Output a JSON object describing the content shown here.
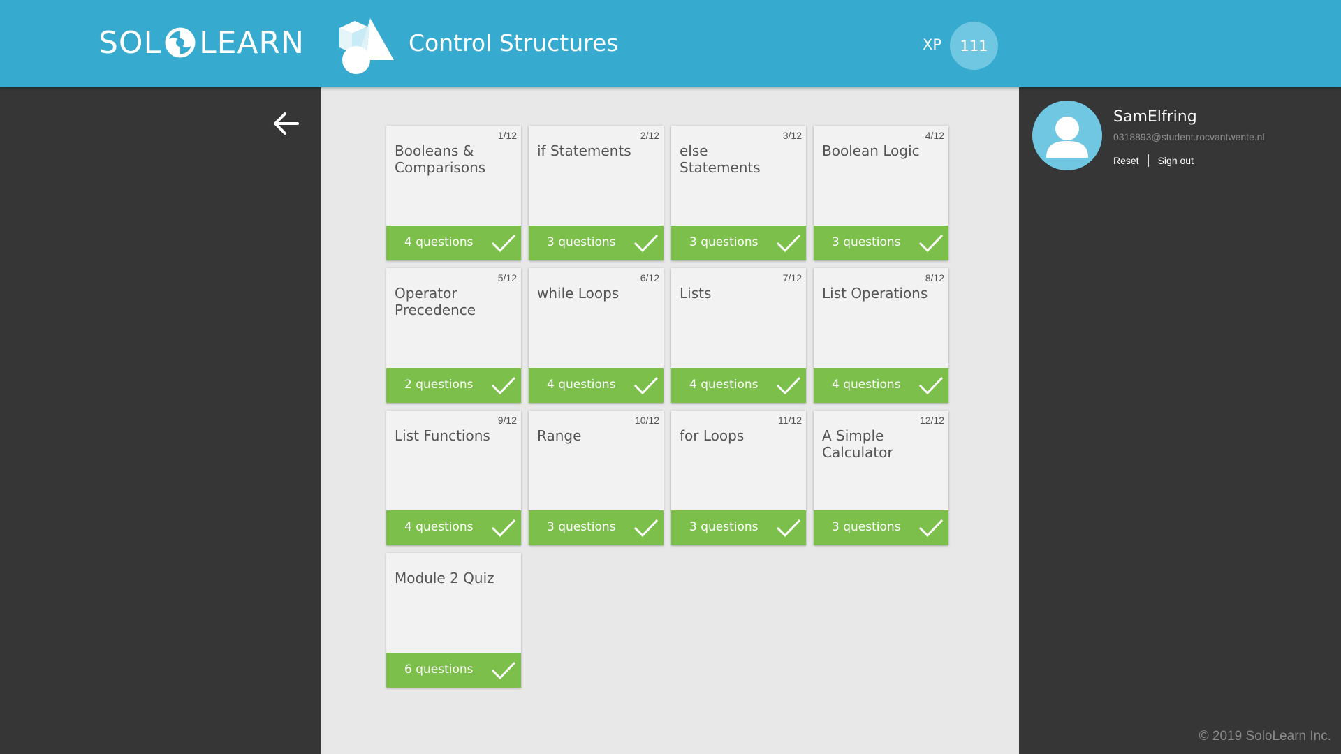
{
  "header": {
    "logo_left": "SOL",
    "logo_right": "LEARN",
    "course_title": "Control Structures",
    "xp_label": "XP",
    "xp_value": "111",
    "background_color": "#37aacf"
  },
  "nav": {
    "back_icon": "arrow-left-icon"
  },
  "lessons": [
    {
      "num": "1/12",
      "title": "Booleans & Comparisons",
      "questions": "4 questions",
      "completed": true
    },
    {
      "num": "2/12",
      "title": "if Statements",
      "questions": "3 questions",
      "completed": true
    },
    {
      "num": "3/12",
      "title": "else Statements",
      "questions": "3 questions",
      "completed": true
    },
    {
      "num": "4/12",
      "title": "Boolean Logic",
      "questions": "3 questions",
      "completed": true
    },
    {
      "num": "5/12",
      "title": "Operator Precedence",
      "questions": "2 questions",
      "completed": true
    },
    {
      "num": "6/12",
      "title": "while Loops",
      "questions": "4 questions",
      "completed": true
    },
    {
      "num": "7/12",
      "title": "Lists",
      "questions": "4 questions",
      "completed": true
    },
    {
      "num": "8/12",
      "title": "List Operations",
      "questions": "4 questions",
      "completed": true
    },
    {
      "num": "9/12",
      "title": "List Functions",
      "questions": "4 questions",
      "completed": true
    },
    {
      "num": "10/12",
      "title": "Range",
      "questions": "3 questions",
      "completed": true
    },
    {
      "num": "11/12",
      "title": "for Loops",
      "questions": "3 questions",
      "completed": true
    },
    {
      "num": "12/12",
      "title": "A Simple Calculator",
      "questions": "3 questions",
      "completed": true
    },
    {
      "num": "",
      "title": "Module 2 Quiz",
      "questions": "6 questions",
      "completed": true
    }
  ],
  "profile": {
    "username": "SamElfring",
    "email": "0318893@student.rocvantwente.nl",
    "reset_label": "Reset",
    "signout_label": "Sign out",
    "avatar_icon": "user-avatar-icon"
  },
  "footer": {
    "copyright": "© 2019 SoloLearn Inc."
  },
  "colors": {
    "accent": "#37aacf",
    "completed_green": "#7cc04b",
    "card_bg": "#f2f2f2",
    "content_bg": "#e8e8e8",
    "sidebar_bg": "#363636"
  }
}
